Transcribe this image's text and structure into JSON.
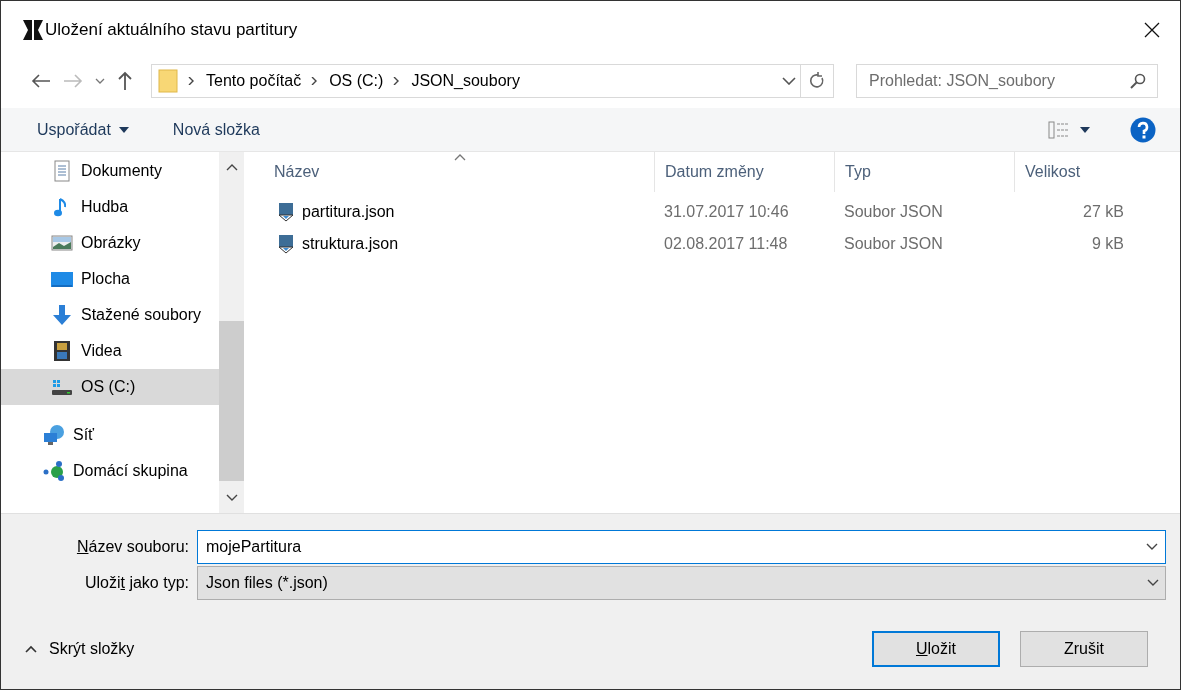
{
  "window": {
    "title": "Uložení aktuálního stavu partitury"
  },
  "nav": {
    "breadcrumb": [
      "Tento počítač",
      "OS (C:)",
      "JSON_soubory"
    ],
    "search": {
      "placeholder": "Prohledat: JSON_soubory"
    }
  },
  "toolbar": {
    "organize": "Uspořádat",
    "new_folder": "Nová složka"
  },
  "sidebar": {
    "pc_items": [
      {
        "kind": "documents",
        "label": "Dokumenty",
        "selected": false
      },
      {
        "kind": "music",
        "label": "Hudba",
        "selected": false
      },
      {
        "kind": "pictures",
        "label": "Obrázky",
        "selected": false
      },
      {
        "kind": "desktop",
        "label": "Plocha",
        "selected": false
      },
      {
        "kind": "downloads",
        "label": "Stažené soubory",
        "selected": false
      },
      {
        "kind": "videos",
        "label": "Videa",
        "selected": false
      },
      {
        "kind": "drive",
        "label": "OS (C:)",
        "selected": true
      }
    ],
    "other_items": [
      {
        "kind": "network",
        "label": "Síť",
        "selected": false
      },
      {
        "kind": "homegroup",
        "label": "Domácí skupina",
        "selected": false
      }
    ]
  },
  "table": {
    "columns": [
      "Název",
      "Datum změny",
      "Typ",
      "Velikost"
    ],
    "rows": [
      {
        "name": "partitura.json",
        "date": "31.07.2017 10:46",
        "type": "Soubor JSON",
        "size": "27 kB"
      },
      {
        "name": "struktura.json",
        "date": "02.08.2017 11:48",
        "type": "Soubor JSON",
        "size": "9 kB"
      }
    ]
  },
  "form": {
    "filename_label": {
      "key": "N",
      "after": "ázev souboru:"
    },
    "filename": "mojePartitura",
    "type_label": {
      "before": "Uloži",
      "key": "t",
      "after": " jako typ:"
    },
    "type_value": "Json files (*.json)"
  },
  "footer": {
    "hide_folders": "Skrýt složky",
    "save": {
      "key": "U",
      "after": "ložit"
    },
    "cancel": "Zrušit"
  }
}
